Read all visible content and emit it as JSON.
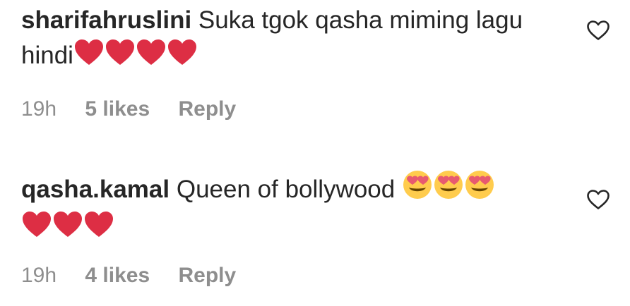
{
  "comments": [
    {
      "username": "sharifahruslini",
      "text": "Suka tgok qasha miming lagu hindi",
      "emojis": [
        "red-heart",
        "red-heart",
        "red-heart",
        "red-heart"
      ],
      "time": "19h",
      "likes": "5 likes",
      "reply": "Reply",
      "like_icon": "heart-outline-icon"
    },
    {
      "username": "qasha.kamal",
      "text": "Queen of bollywood",
      "emojis": [
        "heart-eyes",
        "heart-eyes",
        "heart-eyes",
        "red-heart",
        "red-heart",
        "red-heart"
      ],
      "time": "19h",
      "likes": "4 likes",
      "reply": "Reply",
      "like_icon": "heart-outline-icon"
    }
  ],
  "colors": {
    "text": "#262626",
    "muted": "#8e8e8e",
    "heart": "#dd2e44"
  }
}
